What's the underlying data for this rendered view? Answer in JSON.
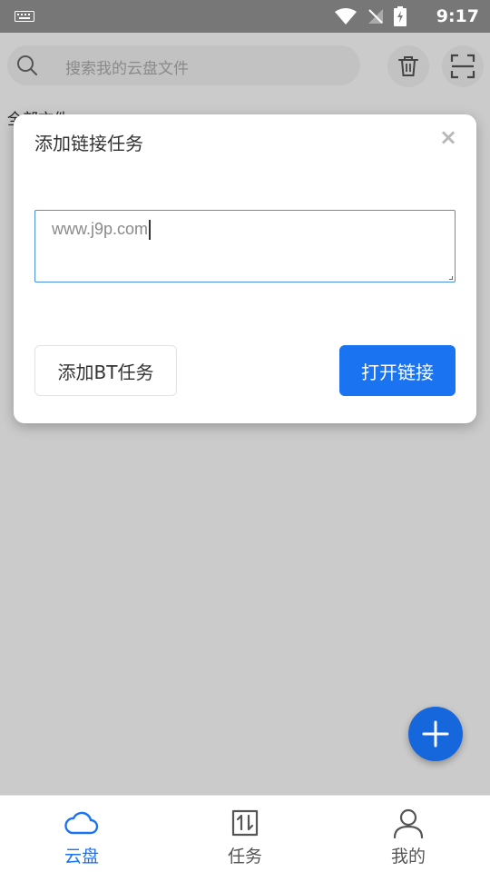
{
  "status_bar": {
    "time": "9:17"
  },
  "header": {
    "search_placeholder": "搜索我的云盘文件"
  },
  "section_label": "全部文件",
  "dialog": {
    "title": "添加链接任务",
    "close_symbol": "×",
    "url_value": "www.j9p.com",
    "bt_button_label": "添加BT任务",
    "open_button_label": "打开链接"
  },
  "bottom_nav": {
    "items": [
      {
        "label": "云盘",
        "icon": "cloud-icon",
        "active": true
      },
      {
        "label": "任务",
        "icon": "transfer-icon",
        "active": false
      },
      {
        "label": "我的",
        "icon": "user-icon",
        "active": false
      }
    ]
  },
  "colors": {
    "accent": "#1a73f0",
    "fab": "#1667db",
    "overlay": "#cbcbcb",
    "status_bar": "#777777"
  }
}
